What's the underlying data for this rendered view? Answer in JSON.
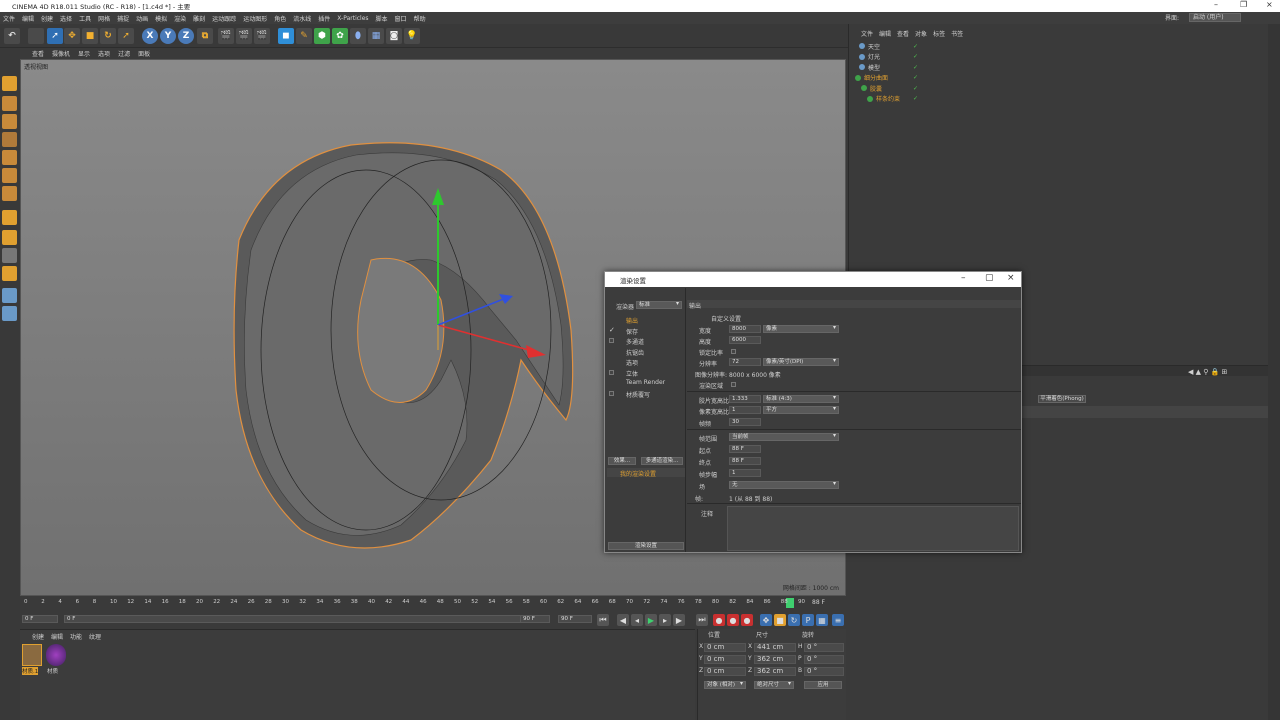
{
  "window": {
    "title": "CINEMA 4D R18.011 Studio (RC - R18) - [1.c4d *] - 主要"
  },
  "menu": [
    "文件",
    "编辑",
    "创建",
    "选择",
    "工具",
    "网格",
    "捕捉",
    "动画",
    "模拟",
    "渲染",
    "雕刻",
    "运动跟踪",
    "运动图形",
    "角色",
    "流水线",
    "插件",
    "X-Particles",
    "脚本",
    "窗口",
    "帮助"
  ],
  "layout": {
    "label": "界面:",
    "value": "启动 (用户)"
  },
  "toolbar": {
    "x": "X",
    "y": "Y",
    "z": "Z"
  },
  "viewport": {
    "menu": [
      "查看",
      "摄像机",
      "显示",
      "选项",
      "过滤",
      "面板"
    ],
    "label": "透视视图",
    "grid_info": "网格间距 : 1000 cm"
  },
  "timeline": {
    "ticks": [
      "0",
      "2",
      "4",
      "6",
      "8",
      "10",
      "12",
      "14",
      "16",
      "18",
      "20",
      "22",
      "24",
      "26",
      "28",
      "30",
      "32",
      "34",
      "36",
      "38",
      "40",
      "42",
      "44",
      "46",
      "48",
      "50",
      "52",
      "54",
      "56",
      "58",
      "60",
      "62",
      "64",
      "66",
      "68",
      "70",
      "72",
      "74",
      "76",
      "78",
      "80",
      "82",
      "84",
      "86",
      "88",
      "90"
    ],
    "current": "88 F",
    "start": "0 F",
    "field2": "0 F",
    "end_a": "90 F",
    "end_b": "90 F"
  },
  "materials": {
    "menu": [
      "创建",
      "编辑",
      "功能",
      "纹理"
    ],
    "items": [
      "材质.1",
      "材质"
    ]
  },
  "coords": {
    "headers": [
      "位置",
      "尺寸",
      "旋转"
    ],
    "rows": [
      {
        "axis": "X",
        "pos": "0 cm",
        "size": "441 cm",
        "rot_axis": "H",
        "rot": "0 °"
      },
      {
        "axis": "Y",
        "pos": "0 cm",
        "size": "362 cm",
        "rot_axis": "P",
        "rot": "0 °"
      },
      {
        "axis": "Z",
        "pos": "0 cm",
        "size": "362 cm",
        "rot_axis": "B",
        "rot": "0 °"
      }
    ],
    "mode1": "对象 (相对)",
    "mode2": "绝对尺寸",
    "apply": "应用"
  },
  "objects": {
    "menu": [
      "文件",
      "编辑",
      "查看",
      "对象",
      "标签",
      "书签"
    ],
    "rows": [
      "天空",
      "灯光",
      "模型",
      "细分曲面",
      "胶囊",
      "样条约束"
    ]
  },
  "attr": {
    "field": "平滑着色(Phong)"
  },
  "dialog": {
    "title": "渲染设置",
    "renderer_label": "渲染器",
    "renderer": "标准",
    "nav": [
      "输出",
      "保存",
      "多通道",
      "抗锯齿",
      "选项",
      "立体",
      "Team Render",
      "材质覆写"
    ],
    "effect_btn": "效果...",
    "multipass_btn": "多通道渲染...",
    "preset": "我的渲染设置",
    "render_settings_btn": "渲染设置",
    "header": "输出",
    "custom": "自定义设置",
    "width_label": "宽度",
    "width": "8000",
    "width_unit": "像素",
    "height_label": "高度",
    "height": "6000",
    "lock_label": "锁定比率",
    "res_label": "分辨率",
    "res": "72",
    "res_unit": "像素/英寸(DPI)",
    "imgres_label": "图像分辨率:",
    "imgres": "8000 x 6000 像素",
    "region_label": "渲染区域",
    "film_label": "胶片宽高比",
    "film": "1.333",
    "film_mode": "标准 (4:3)",
    "pixel_label": "像素宽高比",
    "pixel": "1",
    "pixel_mode": "平方",
    "fps_label": "帧频",
    "fps": "30",
    "range_label": "帧范围",
    "range": "当前帧",
    "start_label": "起点",
    "start": "88 F",
    "end_label": "终点",
    "end": "88 F",
    "step_label": "帧步幅",
    "step": "1",
    "field_label": "场",
    "field": "无",
    "frames_label": "帧:",
    "frames": "1 (从 88 到 88)",
    "notes_label": "注释"
  }
}
